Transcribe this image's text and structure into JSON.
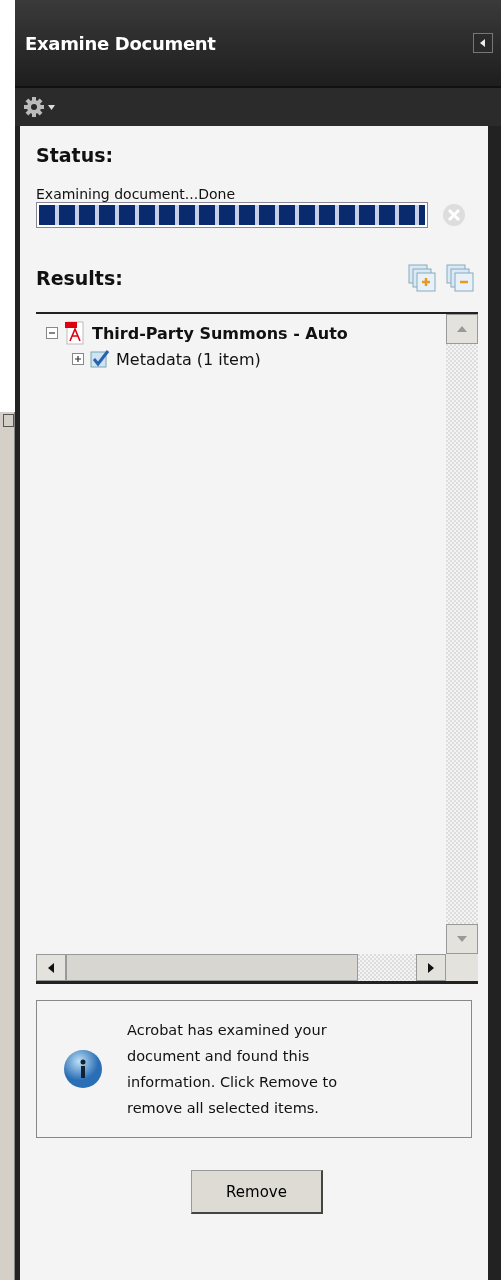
{
  "panel": {
    "title": "Examine Document"
  },
  "status": {
    "label": "Status:",
    "message": "Examining document...Done",
    "level": 1
  },
  "results": {
    "label": "Results:",
    "tree": [
      {
        "label": "Third-Party Summons - Auto",
        "kind": "document",
        "expanded": true,
        "children": [
          {
            "label": "Metadata (1 item)",
            "kind": "category",
            "expanded": false,
            "checked": true
          }
        ]
      }
    ]
  },
  "info": {
    "message": "Acrobat has examined your document and found this information. Click Remove to remove all selected items."
  },
  "buttons": [
    "Remove"
  ]
}
